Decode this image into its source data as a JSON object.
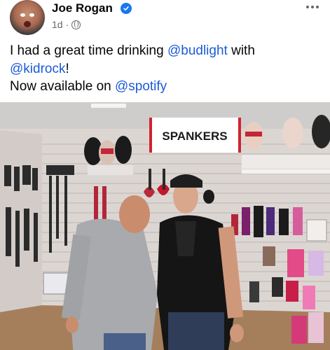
{
  "post": {
    "author": "Joe Rogan",
    "timestamp": "1d",
    "visibility_icon": "globe-icon",
    "verified_icon": "verified-badge-icon",
    "more_icon": "more-options-icon",
    "text": {
      "line1_before": "I had a great time drinking ",
      "mention_budlight": "@budlight",
      "line1_after": " with",
      "mention_kidrock": "@kidrock",
      "line2_after": "!",
      "line3_before": "Now available on ",
      "mention_spotify": "@spotify"
    }
  },
  "photo": {
    "sign_text": "SPANKERS"
  },
  "colors": {
    "link": "#1b5bd8",
    "verified": "#1877f2",
    "secondary_text": "#65676b"
  }
}
